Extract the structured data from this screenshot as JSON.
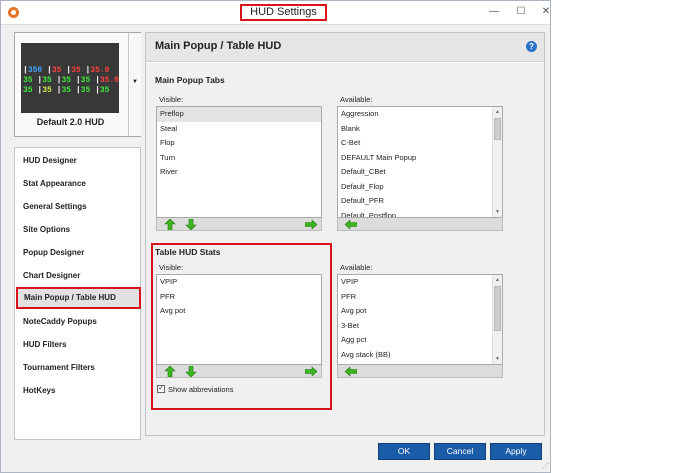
{
  "window": {
    "title": "HUD Settings",
    "minimize": "—",
    "maximize": "☐",
    "close": "✕"
  },
  "hud_preview": {
    "name": "Default 2.0 HUD",
    "dropdown_glyph": "▼",
    "rows": [
      [
        "|350",
        "|35",
        "|35",
        "|35.0"
      ],
      [
        "35",
        "|35",
        "|35",
        "|35",
        "|35.0"
      ],
      [
        "35",
        "|35",
        "|35",
        "|35",
        "|35"
      ]
    ]
  },
  "nav": {
    "items": [
      "HUD Designer",
      "Stat Appearance",
      "General Settings",
      "Site Options",
      "Popup Designer",
      "Chart Designer",
      "Main Popup / Table HUD",
      "NoteCaddy Popups",
      "HUD Filters",
      "Tournament Filters",
      "HotKeys"
    ],
    "active": "Main Popup / Table HUD"
  },
  "main": {
    "title": "Main Popup / Table HUD",
    "help": "?",
    "popup_tabs": {
      "heading": "Main Popup Tabs",
      "visible_label": "Visible:",
      "available_label": "Available:",
      "visible_items": [
        "Preflop",
        "Steal",
        "Flop",
        "Turn",
        "River"
      ],
      "available_items": [
        "Aggression",
        "Blank",
        "C-Bet",
        "DEFAULT Main Popup",
        "Default_CBet",
        "Default_Flop",
        "Default_PFR",
        "Default_Postflop"
      ]
    },
    "table_stats": {
      "heading": "Table HUD Stats",
      "visible_label": "Visible:",
      "available_label": "Available:",
      "visible_items": [
        "VPIP",
        "PFR",
        "Avg pot"
      ],
      "available_items": [
        "VPIP",
        "PFR",
        "Avg pot",
        "3-Bet",
        "Agg pct",
        "Avg stack (BB)"
      ],
      "show_abbreviations_label": "Show abbreviations",
      "show_abbreviations_checked": true
    }
  },
  "footer": {
    "ok": "OK",
    "cancel": "Cancel",
    "apply": "Apply"
  },
  "colors": {
    "highlight_red": "#d9121e",
    "button_blue": "#1b5ca8",
    "arrow_green": "#3cb521"
  }
}
